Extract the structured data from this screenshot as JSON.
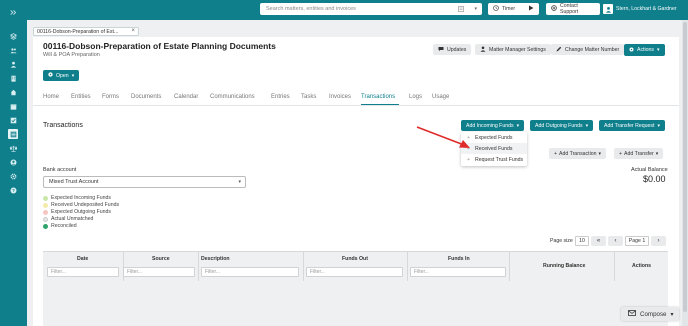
{
  "header": {
    "search_placeholder": "Search matters, entities and invoices",
    "timer_label": "Timer",
    "contact_support_label": "Contact Support",
    "user_name": "Stern, Lockhart & Gardner"
  },
  "open_tab": {
    "label": "00116-Dobson-Preparation of Est..."
  },
  "matter": {
    "title": "00116-Dobson-Preparation of Estate Planning Documents",
    "subtitle": "Will & POA Preparation",
    "updates_label": "Updates",
    "matter_manager_label": "Matter Manager Settings",
    "change_number_label": "Change Matter Number",
    "actions_label": "Actions",
    "status_label": "Open"
  },
  "nav_tabs": [
    {
      "label": "Home"
    },
    {
      "label": "Entities"
    },
    {
      "label": "Forms"
    },
    {
      "label": "Documents"
    },
    {
      "label": "Calendar"
    },
    {
      "label": "Communications"
    },
    {
      "label": "Entries"
    },
    {
      "label": "Tasks"
    },
    {
      "label": "Invoices"
    },
    {
      "label": "Transactions"
    },
    {
      "label": "Logs"
    },
    {
      "label": "Usage"
    }
  ],
  "active_tab": "Transactions",
  "transactions": {
    "title": "Transactions",
    "add_incoming_label": "Add Incoming Funds",
    "add_outgoing_label": "Add Outgoing Funds",
    "add_transfer_request_label": "Add Transfer Request",
    "incoming_menu": [
      {
        "label": "Expected Funds"
      },
      {
        "label": "Received Funds"
      },
      {
        "label": "Request Trust Funds"
      }
    ],
    "add_transaction_label": "Add Transaction",
    "add_transfer_label": "Add Transfer",
    "actual_balance_label": "Actual Balance",
    "actual_balance_value": "$0.00",
    "bank_account_label": "Bank account",
    "bank_account_value": "Mixed Trust Account",
    "legend": [
      {
        "label": "Expected Incoming Funds",
        "color": "#c9e8a8"
      },
      {
        "label": "Received Undeposited Funds",
        "color": "#f3ecaa"
      },
      {
        "label": "Expected Outgoing Funds",
        "color": "#f6c6c2"
      },
      {
        "label": "Actual Unmatched",
        "color": "#e6e6e6"
      },
      {
        "label": "Reconciled",
        "color": "#2fa36b"
      }
    ],
    "page_size_label": "Page size",
    "page_size_value": "10",
    "page_label": "Page 1",
    "columns": {
      "date": "Date",
      "source": "Source",
      "description": "Description",
      "funds_out": "Funds Out",
      "funds_in": "Funds In",
      "running_balance": "Running Balance",
      "actions": "Actions"
    },
    "filter_placeholder": "Filter..."
  },
  "compose_label": "Compose",
  "colors": {
    "teal": "#0f7f8c",
    "arrow": "#e02b2b"
  }
}
